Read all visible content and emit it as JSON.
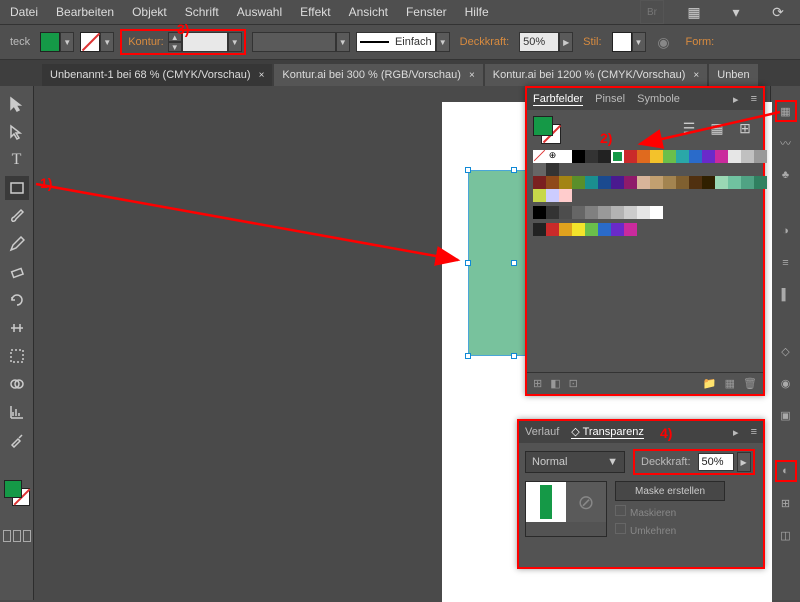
{
  "menu": {
    "items": [
      "Datei",
      "Bearbeiten",
      "Objekt",
      "Schrift",
      "Auswahl",
      "Effekt",
      "Ansicht",
      "Fenster",
      "Hilfe"
    ]
  },
  "propbar": {
    "cornerLabel": "teck",
    "fill": "#159947",
    "konturLabel": "Kontur:",
    "strokeStyle": "Einfach",
    "opacityLabel": "Deckkraft:",
    "opacity": "50%",
    "styleLabel": "Stil:",
    "formLabel": "Form:"
  },
  "tabs": [
    {
      "label": "Unbenannt-1 bei 68 % (CMYK/Vorschau)",
      "active": true
    },
    {
      "label": "Kontur.ai bei 300 % (RGB/Vorschau)",
      "active": false
    },
    {
      "label": "Kontur.ai bei 1200 % (CMYK/Vorschau)",
      "active": false
    },
    {
      "label": "Unben",
      "active": false
    }
  ],
  "swatches": {
    "tabs": [
      "Farbfelder",
      "Pinsel",
      "Symbole"
    ],
    "activeFill": "#159947",
    "rows": [
      [
        "#ffffff",
        "#000000",
        "#333333",
        "#222222",
        "#159947",
        "#ca2a2a",
        "#e06a1e",
        "#f3c22b",
        "#6abf4b",
        "#2aa8a8",
        "#2a6bca",
        "#6a2aca",
        "#ca2a9d",
        "#e6e6e6",
        "#c0c0c0",
        "#999999",
        "#666666",
        "#333333"
      ],
      [
        "#7a2020",
        "#8f4a1a",
        "#a38414",
        "#5a8f2a",
        "#1a8f8f",
        "#1a4a8f",
        "#4a1a8f",
        "#8f1a6a",
        "#d8b49a",
        "#c2a070",
        "#a38450",
        "#806030",
        "#503010",
        "#302000",
        "#9ad8b4",
        "#70c2a0",
        "#50a384",
        "#308060"
      ],
      [
        "#c7d84a",
        "#ccccff",
        "#ffcccc",
        "",
        "",
        "",
        "",
        "",
        "",
        "",
        "",
        "",
        "",
        "",
        "",
        "",
        "",
        ""
      ],
      [
        "#000000",
        "#333333",
        "#4d4d4d",
        "#666666",
        "#808080",
        "#999999",
        "#b3b3b3",
        "#cccccc",
        "#e6e6e6",
        "#ffffff",
        "",
        "",
        "",
        "",
        "",
        "",
        "",
        ""
      ],
      [
        "#222222",
        "#ca2a2a",
        "#e0a21e",
        "#f3e42b",
        "#6abf4b",
        "#2a6bca",
        "#6a2aca",
        "#ca2a9d",
        "",
        "",
        "",
        "",
        "",
        "",
        "",
        "",
        "",
        ""
      ]
    ]
  },
  "transpPanel": {
    "tabs": [
      "Verlauf",
      "Transparenz"
    ],
    "mode": "Normal",
    "opacityLabel": "Deckkraft:",
    "opacity": "50%",
    "mask": "Maske erstellen",
    "maskieren": "Maskieren",
    "umkehren": "Umkehren"
  },
  "ann": {
    "a": "1)",
    "b": "2)",
    "c": "3)",
    "d": "4)"
  }
}
